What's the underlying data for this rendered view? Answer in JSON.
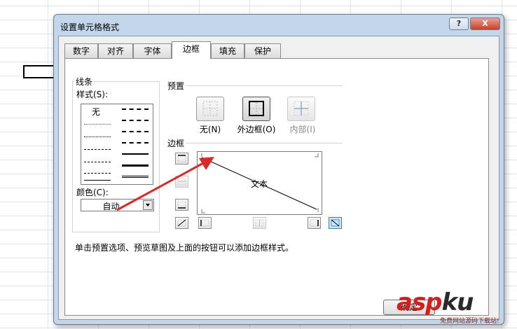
{
  "dialog": {
    "title": "设置单元格格式",
    "help_label": "?",
    "close_label": "X",
    "tabs": [
      {
        "label": "数字"
      },
      {
        "label": "对齐"
      },
      {
        "label": "字体"
      },
      {
        "label": "边框",
        "active": true
      },
      {
        "label": "填充"
      },
      {
        "label": "保护"
      }
    ]
  },
  "line": {
    "group_label": "线条",
    "style_label": "样式(S):",
    "none_label": "无",
    "color_label": "颜色(C):",
    "color_value": "自动"
  },
  "presets": {
    "group_label": "预置",
    "items": [
      {
        "label": "无(N)",
        "icon": "preset-none-icon"
      },
      {
        "label": "外边框(O)",
        "icon": "preset-outline-icon"
      },
      {
        "label": "内部(I)",
        "icon": "preset-inside-icon"
      }
    ]
  },
  "border": {
    "group_label": "边框",
    "preview_text": "文本"
  },
  "instruction": "单击预置选项、预览草图及上面的按钮可以添加边框样式。",
  "buttons": {
    "ok_label": "确定"
  },
  "watermark": {
    "brand_asp": "asp",
    "brand_ku": "ku",
    "subtitle": "免费网站源码下载站!"
  },
  "colors": {
    "accent_red": "#d02121",
    "dialog_frame": "#c3d6ea",
    "selected_border_button": "#cfe6f8"
  }
}
